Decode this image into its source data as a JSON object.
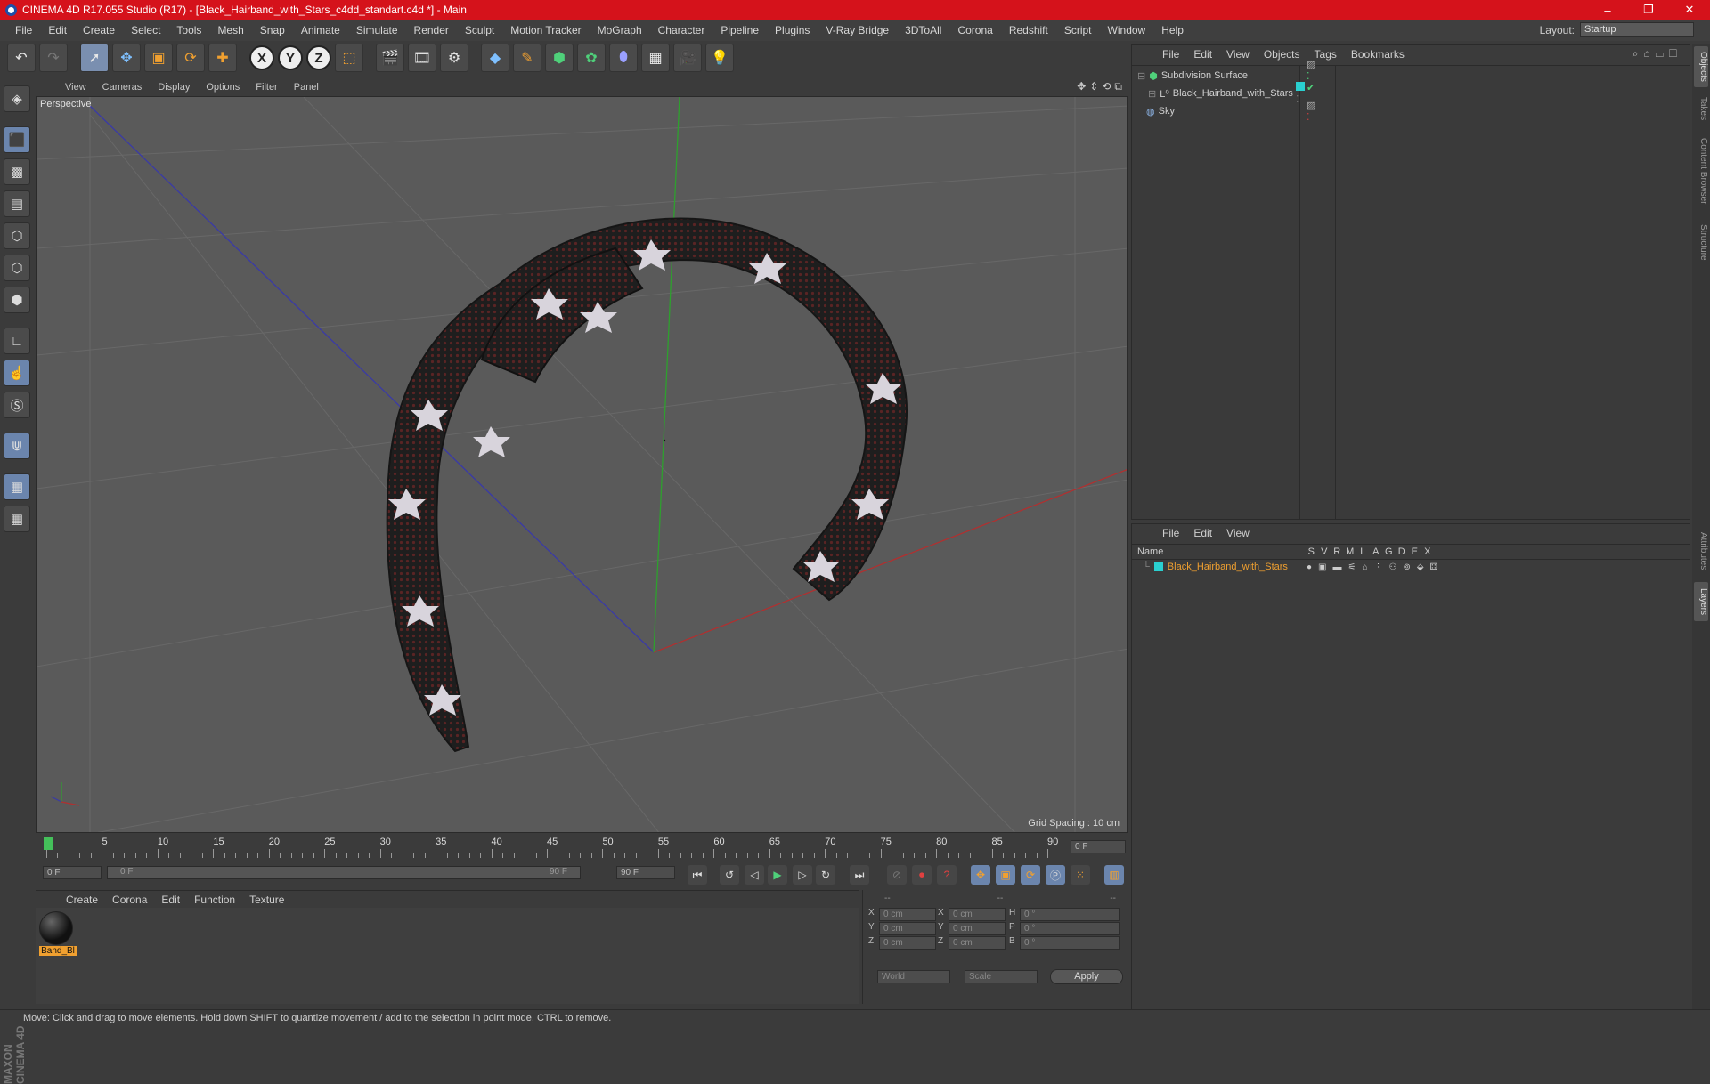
{
  "window": {
    "title": "CINEMA 4D R17.055 Studio (R17) - [Black_Hairband_with_Stars_c4dd_standart.c4d *] - Main",
    "controls": [
      "–",
      "❐",
      "✕"
    ]
  },
  "menubar": {
    "items": [
      "File",
      "Edit",
      "Create",
      "Select",
      "Tools",
      "Mesh",
      "Snap",
      "Animate",
      "Simulate",
      "Render",
      "Sculpt",
      "Motion Tracker",
      "MoGraph",
      "Character",
      "Pipeline",
      "Plugins",
      "V-Ray Bridge",
      "3DToAll",
      "Corona",
      "Redshift",
      "Script",
      "Window",
      "Help"
    ],
    "layout_label": "Layout:",
    "layout_value": "Startup"
  },
  "toolbar": {
    "axis_x": "X",
    "axis_y": "Y",
    "axis_z": "Z"
  },
  "viewport": {
    "menu": [
      "View",
      "Cameras",
      "Display",
      "Options",
      "Filter",
      "Panel"
    ],
    "label": "Perspective",
    "grid_spacing": "Grid Spacing : 10 cm"
  },
  "timeline": {
    "ticks": [
      "0",
      "5",
      "10",
      "15",
      "20",
      "25",
      "30",
      "35",
      "40",
      "45",
      "50",
      "55",
      "60",
      "65",
      "70",
      "75",
      "80",
      "85",
      "90"
    ],
    "current_frame": "0 F",
    "start_field": "0 F",
    "range_start": "0 F",
    "range_end": "90 F",
    "end_field": "90 F"
  },
  "material_manager": {
    "menu": [
      "Create",
      "Corona",
      "Edit",
      "Function",
      "Texture"
    ],
    "materials": [
      {
        "name": "Band_Bl"
      }
    ]
  },
  "coordinates": {
    "header": [
      "--",
      "--",
      "--"
    ],
    "rows": [
      {
        "a": "X",
        "v1": "0 cm",
        "b": "X",
        "v2": "0 cm",
        "c": "H",
        "v3": "0 °"
      },
      {
        "a": "Y",
        "v1": "0 cm",
        "b": "Y",
        "v2": "0 cm",
        "c": "P",
        "v3": "0 °"
      },
      {
        "a": "Z",
        "v1": "0 cm",
        "b": "Z",
        "v2": "0 cm",
        "c": "B",
        "v3": "0 °"
      }
    ],
    "world": "World",
    "scale": "Scale",
    "apply": "Apply"
  },
  "object_manager": {
    "menu": [
      "File",
      "Edit",
      "View",
      "Objects",
      "Tags",
      "Bookmarks"
    ],
    "objects": [
      {
        "name": "Subdivision Surface"
      },
      {
        "name": "Black_Hairband_with_Stars"
      },
      {
        "name": "Sky"
      }
    ]
  },
  "layer_manager": {
    "menu": [
      "File",
      "Edit",
      "View"
    ],
    "columns": [
      "Name",
      "S",
      "V",
      "R",
      "M",
      "L",
      "A",
      "G",
      "D",
      "E",
      "X"
    ],
    "layers": [
      {
        "name": "Black_Hairband_with_Stars"
      }
    ]
  },
  "right_tabs": [
    "Objects",
    "Takes",
    "Content Browser",
    "Structure",
    "Attributes",
    "Layers"
  ],
  "status": "Move: Click and drag to move elements. Hold down SHIFT to quantize movement / add to the selection in point mode, CTRL to remove.",
  "branding": "MAXON CINEMA 4D",
  "colors": {
    "title_bar": "#d5121b",
    "accent_orange": "#f0a030",
    "layer_color": "#2ad0d0"
  }
}
